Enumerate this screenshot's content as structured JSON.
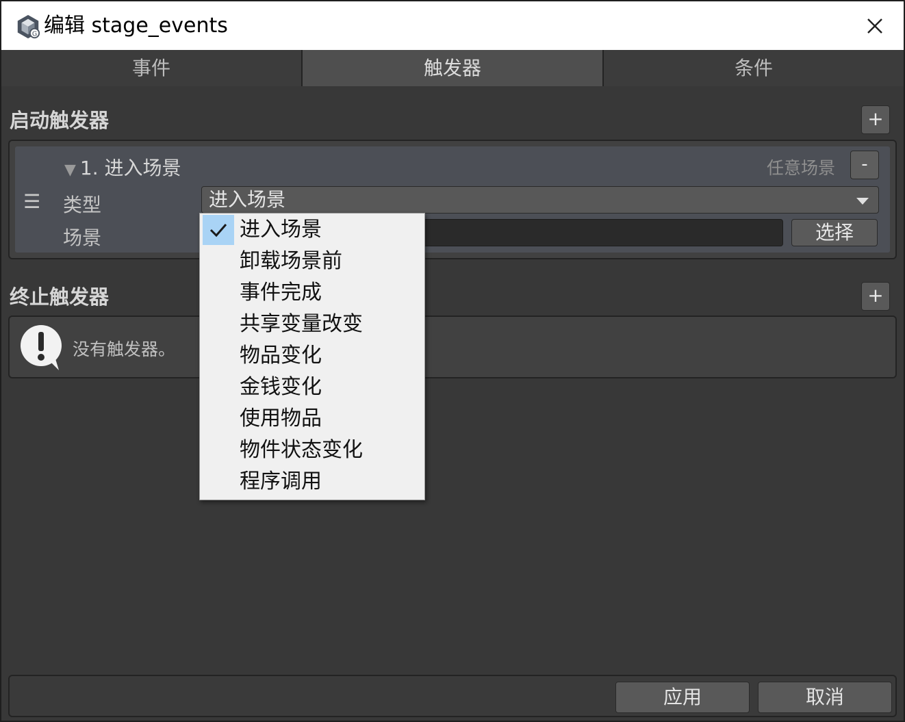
{
  "window": {
    "title": "编辑 stage_events",
    "close_glyph": "✕"
  },
  "tabs": [
    {
      "label": "事件",
      "active": false
    },
    {
      "label": "触发器",
      "active": true
    },
    {
      "label": "条件",
      "active": false
    }
  ],
  "start_triggers": {
    "title": "启动触发器",
    "add_label": "+",
    "items": [
      {
        "header": "1. 进入场景",
        "tag": "任意场景",
        "remove_label": "-",
        "handle_glyph": "☰",
        "type_label": "类型",
        "type_value": "进入场景",
        "scene_label": "场景",
        "choose_label": "选择"
      }
    ]
  },
  "stop_triggers": {
    "title": "终止触发器",
    "add_label": "+",
    "empty_message": "没有触发器。"
  },
  "dropdown": {
    "selected_index": 0,
    "options": [
      "进入场景",
      "卸载场景前",
      "事件完成",
      "共享变量改变",
      "物品变化",
      "金钱变化",
      "使用物品",
      "物件状态变化",
      "程序调用"
    ]
  },
  "footer": {
    "apply_label": "应用",
    "cancel_label": "取消"
  },
  "icons": {
    "app": "unity-logo-icon",
    "notice": "exclamation-speech-bubble-icon",
    "check": "checkmark-icon"
  },
  "colors": {
    "background": "#383838",
    "titlebar": "#ffffff",
    "active_tab": "#4f4f4f",
    "card": "#4c4f56",
    "dropdown_bg": "#f0f0f0",
    "dropdown_selected": "#a9d3f5"
  }
}
